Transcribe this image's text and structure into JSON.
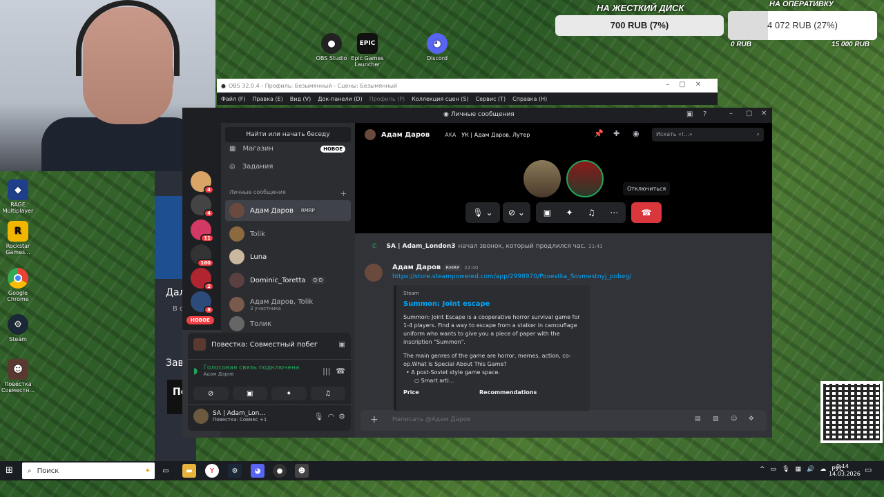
{
  "donation": {
    "hdd_title": "НА ЖЕСТКИЙ ДИСК",
    "hdd_value": "700 RUB (7%)",
    "ram_title": "НА ОПЕРАТИВКУ",
    "ram_value": "4 072 RUB (27%)",
    "ram_fill": 0.27,
    "ram_min": "0 RUB",
    "ram_max": "15 000 RUB"
  },
  "desktop_icons": [
    {
      "label": "OBS Studio"
    },
    {
      "label": "Epic Games Launcher"
    },
    {
      "label": "Discord"
    },
    {
      "label": "RAGE Multiplayer"
    },
    {
      "label": "Rockstar Games..."
    },
    {
      "label": "Google Chrome"
    },
    {
      "label": "Steam"
    },
    {
      "label": "Повестка Совместн..."
    }
  ],
  "obs": {
    "title": "OBS 32.0.4 - Профиль: Безымянный - Сцены: Безымянный",
    "menu": [
      "Файл (F)",
      "Правка (E)",
      "Вид (V)",
      "Док-панели (D)",
      "Профиль (P)",
      "Коллекция сцен (S)",
      "Сервис (T)",
      "Справка (H)"
    ]
  },
  "discord": {
    "window_title": "Личные сообщения",
    "search_button": "Найти или начать беседу",
    "nav": {
      "shop": "Магазин",
      "shop_badge": "НОВОЕ",
      "quests": "Задания"
    },
    "dm_header": "Личные сообщения",
    "dms": [
      {
        "name": "Адам Даров",
        "tag": "RMRP",
        "sub": ""
      },
      {
        "name": "Tolik",
        "tag": "",
        "sub": ""
      },
      {
        "name": "Luna",
        "tag": "",
        "sub": ""
      },
      {
        "name": "Dominic_Toretta",
        "tag": "Q-D",
        "sub": ""
      },
      {
        "name": "Адам Даров, Tolik",
        "tag": "",
        "sub": "3 участника"
      },
      {
        "name": "Толик",
        "tag": "",
        "sub": ""
      }
    ],
    "server_badges": [
      "4",
      "4",
      "11",
      "160",
      "2",
      "8"
    ],
    "new_pill": "НОВОЕ",
    "activity": "Повестка: Совместный побег",
    "voice": {
      "status": "Голосовая связь подключена",
      "user": "Адам Даров"
    },
    "user_panel": {
      "name": "SA | Adam_Lon...",
      "status": "Повестка: Совмес +1"
    },
    "chat_header": {
      "name": "Адам Даров",
      "aka_label": "AKA",
      "aka": "УК | Адам Даров, Лутер",
      "search_placeholder": "Искать «!...»"
    },
    "tooltip": "Отключиться",
    "call_log": {
      "user": "SA | Adam_London3",
      "text": "начал звонок, который продлился час.",
      "time": "21:43"
    },
    "message": {
      "author": "Адам Даров",
      "tag": "RMRP",
      "time": "22:40",
      "link": "https://store.steampowered.com/app/2998970/Povestka_Sovmestnyj_pobeg/"
    },
    "embed": {
      "provider": "Steam",
      "title": "Summon: Joint escape",
      "desc1": "Summon: Joint Escape is a cooperative horror survival game for 1-4 players. Find a way to escape from a stalker in camouflage uniform who wants to give you a piece of paper with the inscription \"Summon\".",
      "desc2": "The main genres of the game are horror, memes, action, co-op.What Is Special About This Game?",
      "bullet1": "A post-Soviet style game space.",
      "bullet2": "Smart arti...",
      "field1": "Price",
      "field2": "Recommendations"
    },
    "composer_placeholder": "Написать @Адам Даров",
    "side_text": {
      "dal": "Дал",
      "vcs": "В с",
      "zav": "Зав",
      "po": "По"
    }
  },
  "taskbar": {
    "search": "Поиск",
    "lang": "РУС",
    "time": "0:14",
    "date": "14.03.2026"
  }
}
